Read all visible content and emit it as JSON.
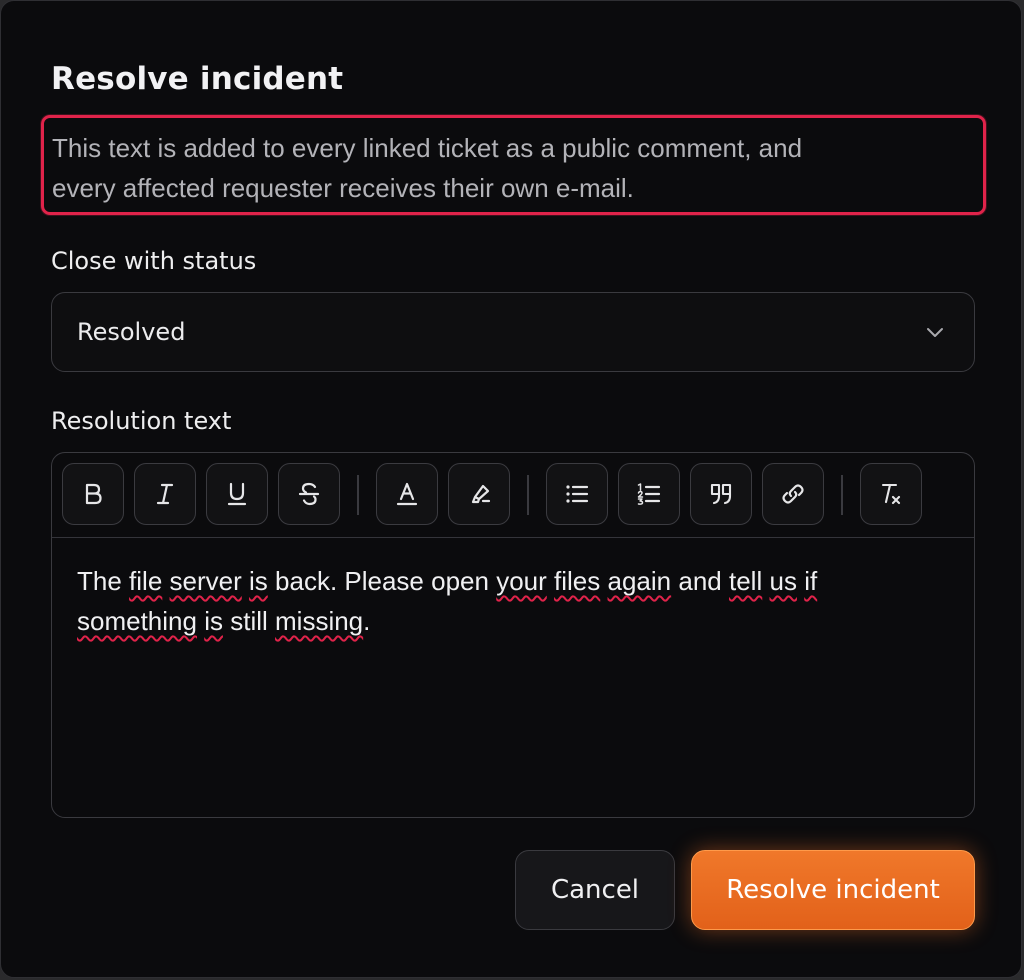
{
  "dialog": {
    "title": "Resolve incident",
    "description_line1": "This text is added to every linked ticket as a public comment, and",
    "description_line2": "every affected requester receives their own e-mail."
  },
  "status": {
    "label": "Close with status",
    "value": "Resolved",
    "icon": "chevron-down-icon"
  },
  "resolution": {
    "label": "Resolution text",
    "toolbar": [
      {
        "name": "bold",
        "icon": "bold-icon"
      },
      {
        "name": "italic",
        "icon": "italic-icon"
      },
      {
        "name": "underline",
        "icon": "underline-icon"
      },
      {
        "name": "strikethrough",
        "icon": "strikethrough-icon"
      },
      {
        "name": "text-color",
        "icon": "text-color-icon"
      },
      {
        "name": "highlight",
        "icon": "highlighter-icon"
      },
      {
        "name": "bullet-list",
        "icon": "bullet-list-icon"
      },
      {
        "name": "numbered-list",
        "icon": "numbered-list-icon"
      },
      {
        "name": "blockquote",
        "icon": "quote-icon"
      },
      {
        "name": "link",
        "icon": "link-icon"
      },
      {
        "name": "clear-formatting",
        "icon": "clear-formatting-icon"
      }
    ],
    "content": {
      "w1": "The",
      "w2": "file",
      "w3": "server",
      "w4": "is",
      "w5": "back. Please",
      "w6": "open",
      "w7": "your",
      "w8": "files",
      "w9": "again",
      "w10": "and",
      "w11": "tell",
      "w12": "us",
      "w13": "if",
      "w14": "something",
      "w15": "is",
      "w16": "still",
      "w17": "missing",
      "w18": "."
    }
  },
  "actions": {
    "cancel_label": "Cancel",
    "primary_label": "Resolve incident"
  },
  "colors": {
    "accent": "#f0782a",
    "focus_ring": "#e0234a",
    "background": "#0b0b0d"
  }
}
